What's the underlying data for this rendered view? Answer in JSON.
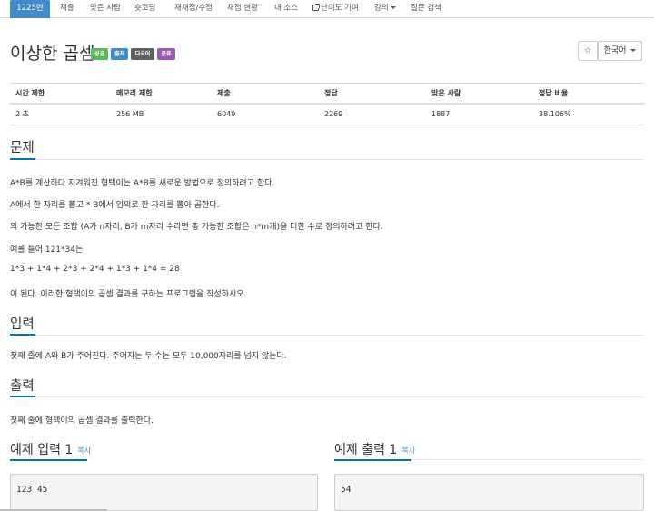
{
  "nav": {
    "items": [
      {
        "label": "1225번"
      },
      {
        "label": "제출"
      },
      {
        "label": "맞은 사람"
      },
      {
        "label": "숏코딩"
      },
      {
        "label": "재채점/수정"
      },
      {
        "label": "채점 현황"
      },
      {
        "label": "내 소스"
      },
      {
        "label": "난이도 기여"
      },
      {
        "label": "강의"
      },
      {
        "label": "질문 검색"
      }
    ]
  },
  "problem": {
    "title": "이상한 곱셈",
    "labels": [
      "성공",
      "출처",
      "다국어",
      "분류"
    ],
    "star_button": "☆",
    "language_button": "한국어"
  },
  "info_table": {
    "headers": [
      "시간 제한",
      "메모리 제한",
      "제출",
      "정답",
      "맞은 사람",
      "정답 비율"
    ],
    "row": [
      "2 초",
      "256 MB",
      "6049",
      "2269",
      "1887",
      "38.106%"
    ]
  },
  "sections": {
    "problem": {
      "heading": "문제",
      "lines": [
        "A*B를 계산하다 지겨워진 형택이는 A*B를 새로운 방법으로 정의하려고 한다.",
        "A에서 한 자리를 뽑고 * B에서 임의로 한 자리를 뽑아 곱한다.",
        "의 가능한 모든 조합 (A가 n자리, B가 m자리 수라면 총 가능한 조합은 n*m개)을 더한 수로 정의하려고 한다.",
        "예를 들어 121*34는",
        "1*3 + 1*4 + 2*3 + 2*4 + 1*3 + 1*4 = 28",
        "이 된다. 이러한 형택이의 곱셈 결과를 구하는 프로그램을 작성하시오."
      ]
    },
    "input": {
      "heading": "입력",
      "text": "첫째 줄에 A와 B가 주어진다. 주어지는 두 수는 모두 10,000자리를 넘지 않는다."
    },
    "output": {
      "heading": "출력",
      "text": "첫째 줄에 형택이의 곱셈 결과를 출력한다."
    }
  },
  "samples": {
    "input_heading": "예제 입력 1",
    "output_heading": "예제 출력 1",
    "copy_label": "복사",
    "input_value": "123 45",
    "output_value": "54"
  },
  "colors": {
    "nav_active": "#428bca",
    "accent_underline": "#0076c0",
    "label_success": "#5cb85c",
    "label_primary": "#428bca",
    "label_default": "#5f5f5f",
    "label_purple": "#9b59b6"
  }
}
